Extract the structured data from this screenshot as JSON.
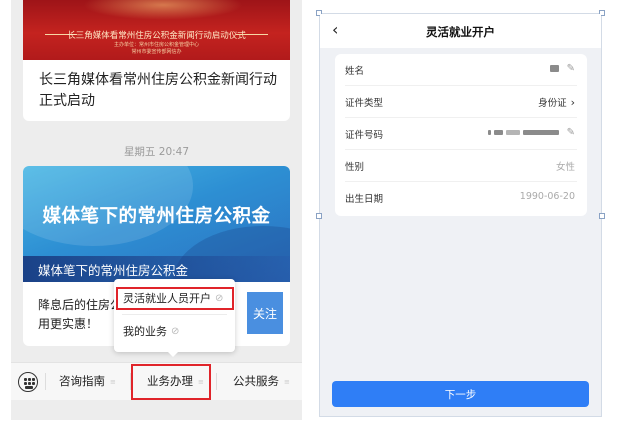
{
  "left_screen": {
    "article1": {
      "banner_title": "长三角媒体看常州住房公积金新闻行动启动仪式",
      "banner_org_lines": [
        "主办单位：常州市住房公积金管理中心",
        "常州市委宣传部网信办"
      ],
      "title": "长三角媒体看常州住房公积金新闻行动正式启动"
    },
    "timestamp": "星期五 20:47",
    "article2": {
      "banner_big": "媒体笔下的常州住房公积金",
      "banner_sub": "媒体笔下的常州住房公积金",
      "text": "降息后的住房公积金用更实惠！",
      "follow_label": "关注"
    },
    "popup_menu": {
      "items": [
        {
          "label": "灵活就业人员开户",
          "icon": "link-icon",
          "highlighted": true
        },
        {
          "label": "我的业务",
          "icon": "link-icon",
          "highlighted": false
        }
      ]
    },
    "bottom_menu": {
      "keyboard_icon": "keyboard-icon",
      "items": [
        {
          "label": "咨询指南",
          "highlighted": false
        },
        {
          "label": "业务办理",
          "highlighted": true
        },
        {
          "label": "公共服务",
          "highlighted": false
        }
      ],
      "submenu_glyph": "≡"
    },
    "highlight_color": "#e0242a"
  },
  "right_screen": {
    "title": "灵活就业开户",
    "back_icon": "chevron-left-icon",
    "fields": [
      {
        "label": "姓名",
        "value": "",
        "masked": true,
        "action_icon": "pencil-icon"
      },
      {
        "label": "证件类型",
        "value": "身份证",
        "masked": false,
        "action_icon": "chevron-right-icon"
      },
      {
        "label": "证件号码",
        "value": "",
        "masked": true,
        "action_icon": "pencil-icon"
      },
      {
        "label": "性别",
        "value": "女性",
        "masked": false,
        "action_icon": ""
      },
      {
        "label": "出生日期",
        "value": "1990-06-20",
        "masked": false,
        "action_icon": ""
      }
    ],
    "next_button": "下一步",
    "accent_color": "#2f7ef6"
  }
}
